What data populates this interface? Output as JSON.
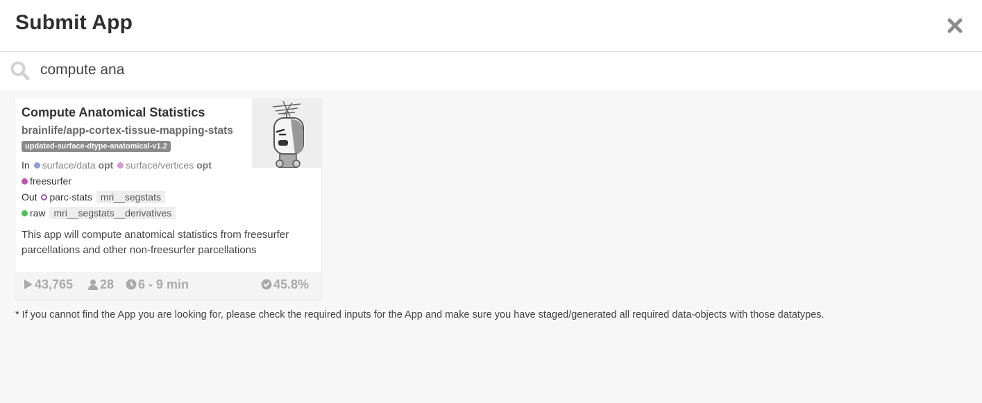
{
  "header": {
    "title": "Submit App",
    "close_icon": "close-icon"
  },
  "search": {
    "value": "compute ana",
    "placeholder": "",
    "icon": "search-icon"
  },
  "app_card": {
    "name": "Compute Anatomical Statistics",
    "repo": "brainlife/app-cortex-tissue-mapping-stats",
    "branch": "updated-surface-dtype-anatomical-v1.2",
    "inputs_label": "In",
    "inputs": [
      {
        "datatype": "surface/data",
        "opt": "opt",
        "color": "#8e9fd6"
      },
      {
        "datatype": "surface/vertices",
        "opt": "opt",
        "color": "#d89ad0"
      },
      {
        "datatype": "freesurfer",
        "opt": "",
        "color": "#c052b0"
      }
    ],
    "outputs_label": "Out",
    "outputs": [
      {
        "datatype": "parc-stats",
        "tag": "mri__segstats",
        "color": "#9b59b6"
      },
      {
        "datatype": "raw",
        "tag": "mri__segstats__derivatives",
        "color": "#4cc25a"
      }
    ],
    "description": "This app will compute anatomical statistics from freesurfer parcellations and other non-freesurfer parcellations",
    "stats": {
      "runs": "43,765",
      "users": "28",
      "runtime": "6 - 9 min",
      "success_rate": "45.8%"
    }
  },
  "footnote": "* If you cannot find the App you are looking for, please check the required inputs for the App and make sure you have staged/generated all required data-objects with those datatypes."
}
